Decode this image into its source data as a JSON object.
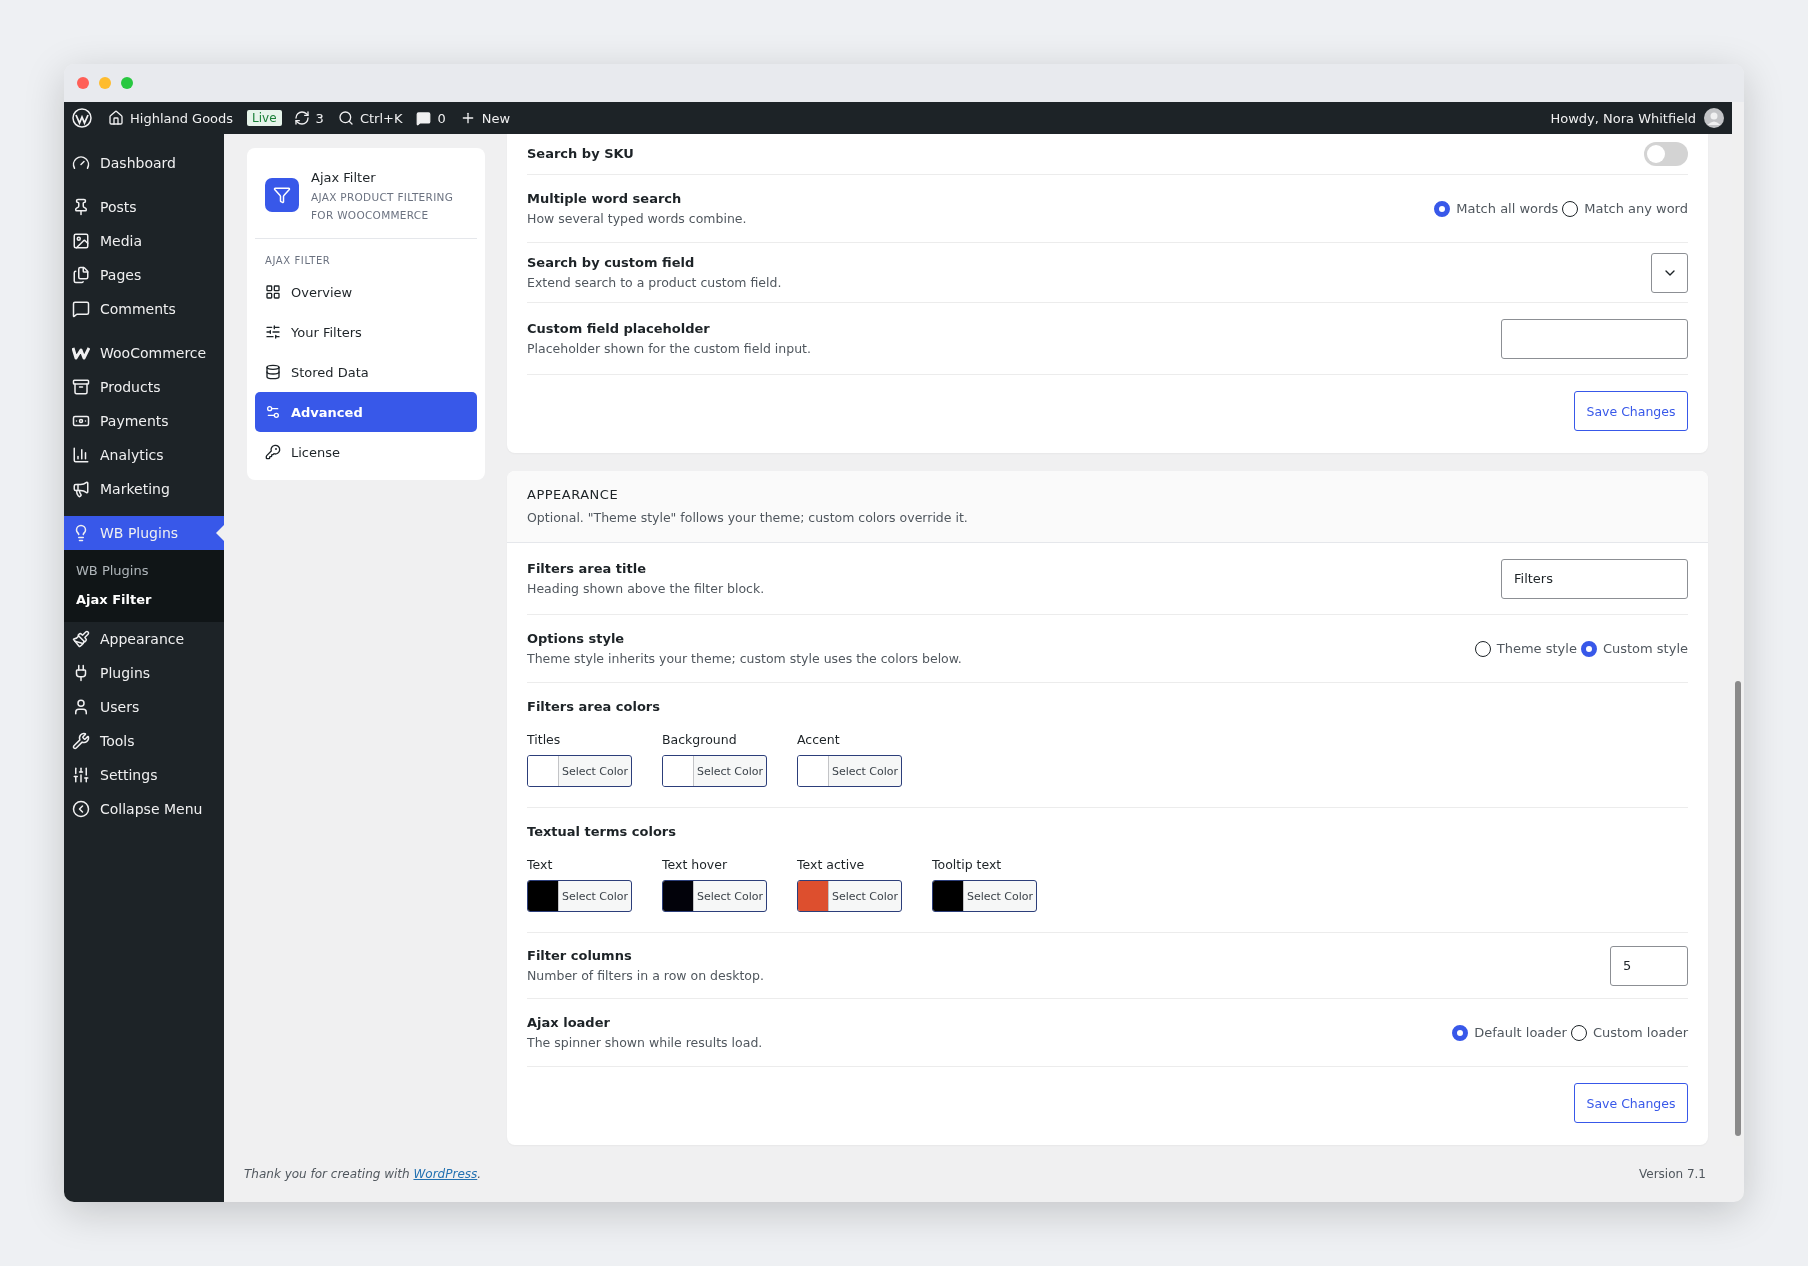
{
  "admin_bar": {
    "site": "Highland Goods",
    "badge": "Live",
    "updates": "3",
    "search": "Ctrl+K",
    "comments": "0",
    "new": "New",
    "greeting": "Howdy, Nora Whitfield"
  },
  "sidebar": {
    "groups": [
      [
        {
          "label": "Dashboard",
          "selected": false
        }
      ],
      [
        {
          "label": "Posts",
          "selected": false
        },
        {
          "label": "Media",
          "selected": false
        },
        {
          "label": "Pages",
          "selected": false
        },
        {
          "label": "Comments",
          "selected": false
        }
      ],
      [
        {
          "label": "WooCommerce",
          "selected": false
        },
        {
          "label": "Products",
          "selected": false
        },
        {
          "label": "Payments",
          "selected": false
        },
        {
          "label": "Analytics",
          "selected": false
        },
        {
          "label": "Marketing",
          "selected": false
        }
      ],
      [
        {
          "label": "WB Plugins",
          "selected": true,
          "children": [
            {
              "label": "WB Plugins",
              "selected": false
            },
            {
              "label": "Ajax Filter",
              "selected": true
            }
          ]
        },
        {
          "label": "Appearance",
          "selected": false
        },
        {
          "label": "Plugins",
          "selected": false
        },
        {
          "label": "Users",
          "selected": false
        },
        {
          "label": "Tools",
          "selected": false
        },
        {
          "label": "Settings",
          "selected": false
        },
        {
          "label": "Collapse Menu",
          "selected": false
        }
      ]
    ]
  },
  "plugin_nav": {
    "title": "Ajax Filter",
    "subtitle": "AJAX PRODUCT FILTERING FOR WOOCOMMERCE",
    "section": "AJAX FILTER",
    "items": [
      {
        "label": "Overview",
        "selected": false
      },
      {
        "label": "Your Filters",
        "selected": false
      },
      {
        "label": "Stored Data",
        "selected": false
      },
      {
        "label": "Advanced",
        "selected": true
      },
      {
        "label": "License",
        "selected": false
      }
    ]
  },
  "search_card": {
    "rows": [
      {
        "kind": "toggle",
        "label": "Search by SKU",
        "on": false
      },
      {
        "kind": "radio",
        "label": "Multiple word search",
        "description": "How several typed words combine.",
        "options": [
          {
            "label": "Match all words",
            "selected": true
          },
          {
            "label": "Match any word",
            "selected": false
          }
        ]
      },
      {
        "kind": "select",
        "label": "Search by custom field",
        "description": "Extend search to a product custom field."
      },
      {
        "kind": "text",
        "label": "Custom field placeholder",
        "description": "Placeholder shown for the custom field input."
      }
    ],
    "save_button": "Save Changes"
  },
  "appearance_card": {
    "title": "APPEARANCE",
    "description": "Optional. \"Theme style\" follows your theme; custom colors override it.",
    "rows": [
      {
        "kind": "text",
        "label": "Filters area title",
        "description": "Heading shown above the filter block.",
        "value": "Filters"
      },
      {
        "kind": "radio",
        "label": "Options style",
        "description": "Theme style inherits your theme; custom style uses the colors below.",
        "options": [
          {
            "label": "Theme style",
            "selected": false
          },
          {
            "label": "Custom style",
            "selected": true
          }
        ]
      },
      {
        "kind": "colors",
        "label": "Filters area colors",
        "swatches": [
          {
            "label": "Titles",
            "color": "#ffffff",
            "button": "Select Color"
          },
          {
            "label": "Background",
            "color": "#ffffff",
            "button": "Select Color"
          },
          {
            "label": "Accent",
            "color": "#ffffff",
            "button": "Select Color"
          }
        ]
      },
      {
        "kind": "colors",
        "label": "Textual terms colors",
        "swatches": [
          {
            "label": "Text",
            "color": "#000000",
            "button": "Select Color"
          },
          {
            "label": "Text hover",
            "color": "#02020a",
            "button": "Select Color"
          },
          {
            "label": "Text active",
            "color": "#dd4f2e",
            "button": "Select Color"
          },
          {
            "label": "Tooltip text",
            "color": "#000000",
            "button": "Select Color"
          }
        ]
      },
      {
        "kind": "number",
        "label": "Filter columns",
        "description": "Number of filters in a row on desktop.",
        "value": "5"
      },
      {
        "kind": "radio",
        "label": "Ajax loader",
        "description": "The spinner shown while results load.",
        "options": [
          {
            "label": "Default loader",
            "selected": true
          },
          {
            "label": "Custom loader",
            "selected": false
          }
        ]
      }
    ],
    "save_button": "Save Changes"
  },
  "footer": {
    "credit": "Thank you for creating with ",
    "link": "WordPress",
    "credit_end": ".",
    "version": "Version 7.1"
  }
}
